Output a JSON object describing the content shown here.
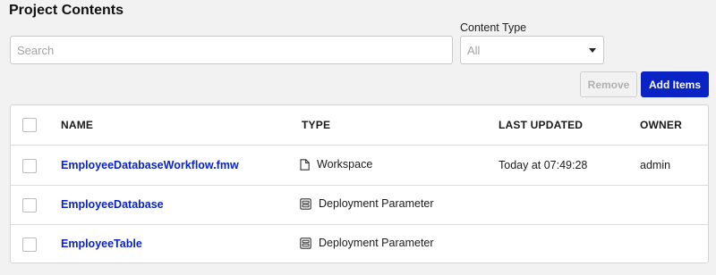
{
  "page": {
    "title": "Project Contents"
  },
  "search": {
    "placeholder": "Search",
    "value": ""
  },
  "content_type": {
    "label": "Content Type",
    "selected": "All"
  },
  "buttons": {
    "remove": "Remove",
    "add_items": "Add Items"
  },
  "table": {
    "headers": {
      "name": "NAME",
      "type": "TYPE",
      "last_updated": "LAST UPDATED",
      "owner": "OWNER"
    },
    "rows": [
      {
        "name": "EmployeeDatabaseWorkflow.fmw",
        "type": "Workspace",
        "type_icon": "file-icon",
        "last_updated": "Today at 07:49:28",
        "owner": "admin"
      },
      {
        "name": "EmployeeDatabase",
        "type": "Deployment Parameter",
        "type_icon": "parameter-icon",
        "last_updated": "",
        "owner": ""
      },
      {
        "name": "EmployeeTable",
        "type": "Deployment Parameter",
        "type_icon": "parameter-icon",
        "last_updated": "",
        "owner": ""
      }
    ]
  },
  "colors": {
    "accent": "#0a23c4",
    "background": "#f2f2f2"
  }
}
